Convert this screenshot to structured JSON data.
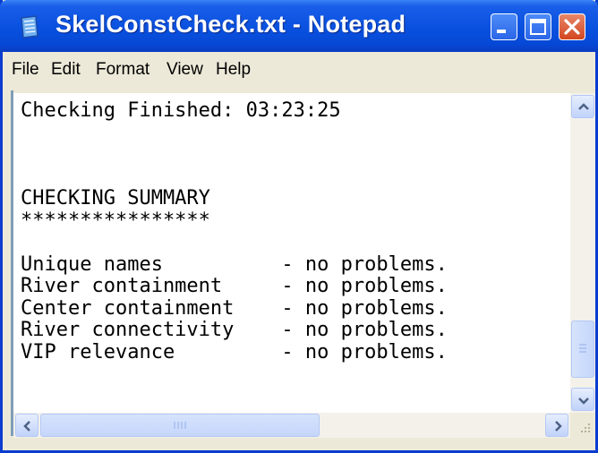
{
  "window": {
    "title": "SkelConstCheck.txt - Notepad",
    "title_color": "#ffffff",
    "titlebar_color": "#0a52e0",
    "close_color": "#d2461f"
  },
  "menu": {
    "items": [
      {
        "label": "File"
      },
      {
        "label": "Edit"
      },
      {
        "label": "Format"
      },
      {
        "label": "View"
      },
      {
        "label": "Help"
      }
    ]
  },
  "document": {
    "content": "Checking Finished: 03:23:25\n\n\n\nCHECKING SUMMARY\n****************\n\nUnique names          - no problems.\nRiver containment     - no problems.\nCenter containment    - no problems.\nRiver connectivity    - no problems.\nVIP relevance         - no problems."
  },
  "icons": {
    "app": "notepad-icon",
    "minimize": "minimize-icon",
    "maximize": "maximize-icon",
    "close": "close-icon",
    "scroll_up": "arrow-up-icon",
    "scroll_down": "arrow-down-icon",
    "scroll_left": "arrow-left-icon",
    "scroll_right": "arrow-right-icon",
    "resize": "resize-grip-icon"
  }
}
